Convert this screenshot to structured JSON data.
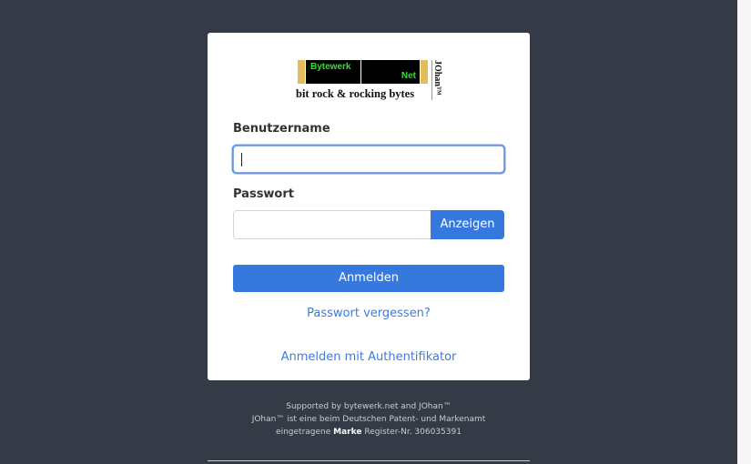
{
  "logo": {
    "left_text": "Bytewerk",
    "right_text": "Net",
    "slogan": "bit rock & rocking bytes",
    "vertical_text": "JOhan™"
  },
  "login": {
    "username_label": "Benutzername",
    "username_value": "",
    "password_label": "Passwort",
    "password_value": "",
    "show_button": "Anzeigen",
    "submit_button": "Anmelden",
    "forgot_link": "Passwort vergessen?",
    "authenticator_link": "Anmelden mit Authentifikator"
  },
  "footer": {
    "line1": "Supported by bytewerk.net and JOhan™",
    "line2": "JOhan™ ist eine beim Deutschen Patent- und Markenamt",
    "line3_prefix": "eingetragene",
    "line3_bold": "Marke",
    "line3_suffix": "Register-Nr. 306035391"
  },
  "colors": {
    "background": "#343a46",
    "accent": "#3579df",
    "link": "#3d7be0",
    "logo_gold": "#e3bd5b",
    "logo_green": "#2be52b"
  }
}
